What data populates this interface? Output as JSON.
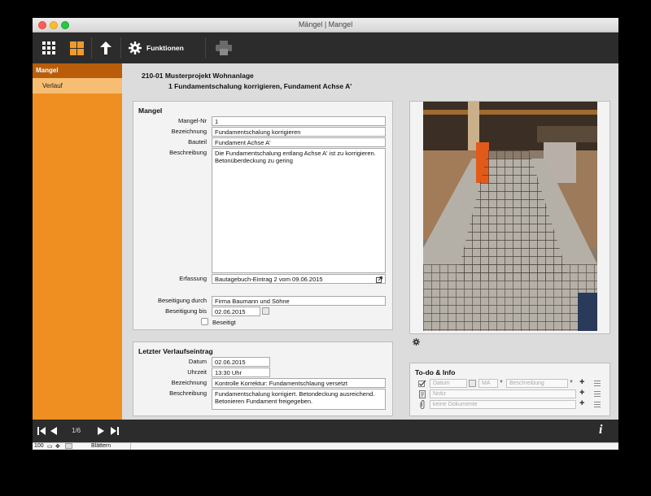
{
  "window": {
    "title": "Mängel | Mangel"
  },
  "toolbar": {
    "funktionen_label": "Funktionen"
  },
  "sidebar": {
    "items": [
      {
        "label": "Mangel"
      },
      {
        "label": "Verlauf"
      }
    ]
  },
  "header": {
    "project": "210-01 Musterprojekt Wohnanlage",
    "defect": "1 Fundamentschalung korrigieren, Fundament Achse A'"
  },
  "mangel": {
    "title": "Mangel",
    "labels": {
      "nr": "Mangel-Nr",
      "bezeichnung": "Bezeichnung",
      "bauteil": "Bauteil",
      "beschreibung": "Beschreibung",
      "erfassung": "Erfassung",
      "beseitigung_durch": "Beseitigung durch",
      "beseitigung_bis": "Beseitigung bis",
      "beseitigt": "Beseitigt"
    },
    "values": {
      "nr": "1",
      "bezeichnung": "Fundamentschalung korrigieren",
      "bauteil": "Fundament Achse A'",
      "beschreibung": "Die Fundamentschalung entlang Achse A' ist zu korrigieren. Betonüberdeckung zu gering",
      "erfassung": "Bautagebuch-Eintrag 2 vom 09.06.2015",
      "beseitigung_durch": "Firma Baumann und Söhne",
      "beseitigung_bis": "02.06.2015",
      "beseitigt": false
    }
  },
  "verlauf": {
    "title": "Letzter Verlaufseintrag",
    "labels": {
      "datum": "Datum",
      "uhrzeit": "Uhrzeit",
      "bezeichnung": "Bezeichnung",
      "beschreibung": "Beschreibung"
    },
    "values": {
      "datum": "02.06.2015",
      "uhrzeit": "13:30 Uhr",
      "bezeichnung": "Kontrolle Korrektur: Fundamentschlaung versetzt",
      "beschreibung": "Fundamentschalung korrigiert. Betondeckung ausreichend. Betonieren Fundament freigegeben."
    }
  },
  "todo": {
    "title": "To-do & Info",
    "datum_placeholder": "Datum",
    "ma_placeholder": "MA",
    "beschreibung_placeholder": "Beschreibung",
    "notiz_placeholder": "Notiz",
    "dokumente_placeholder": "keine Dokumente"
  },
  "footer": {
    "counter": "1/6",
    "zoom": "100",
    "mode": "Blättern"
  },
  "colors": {
    "accent": "#ef8f22",
    "accent_dark": "#b85d0a",
    "toolbar": "#2c2c2c"
  }
}
